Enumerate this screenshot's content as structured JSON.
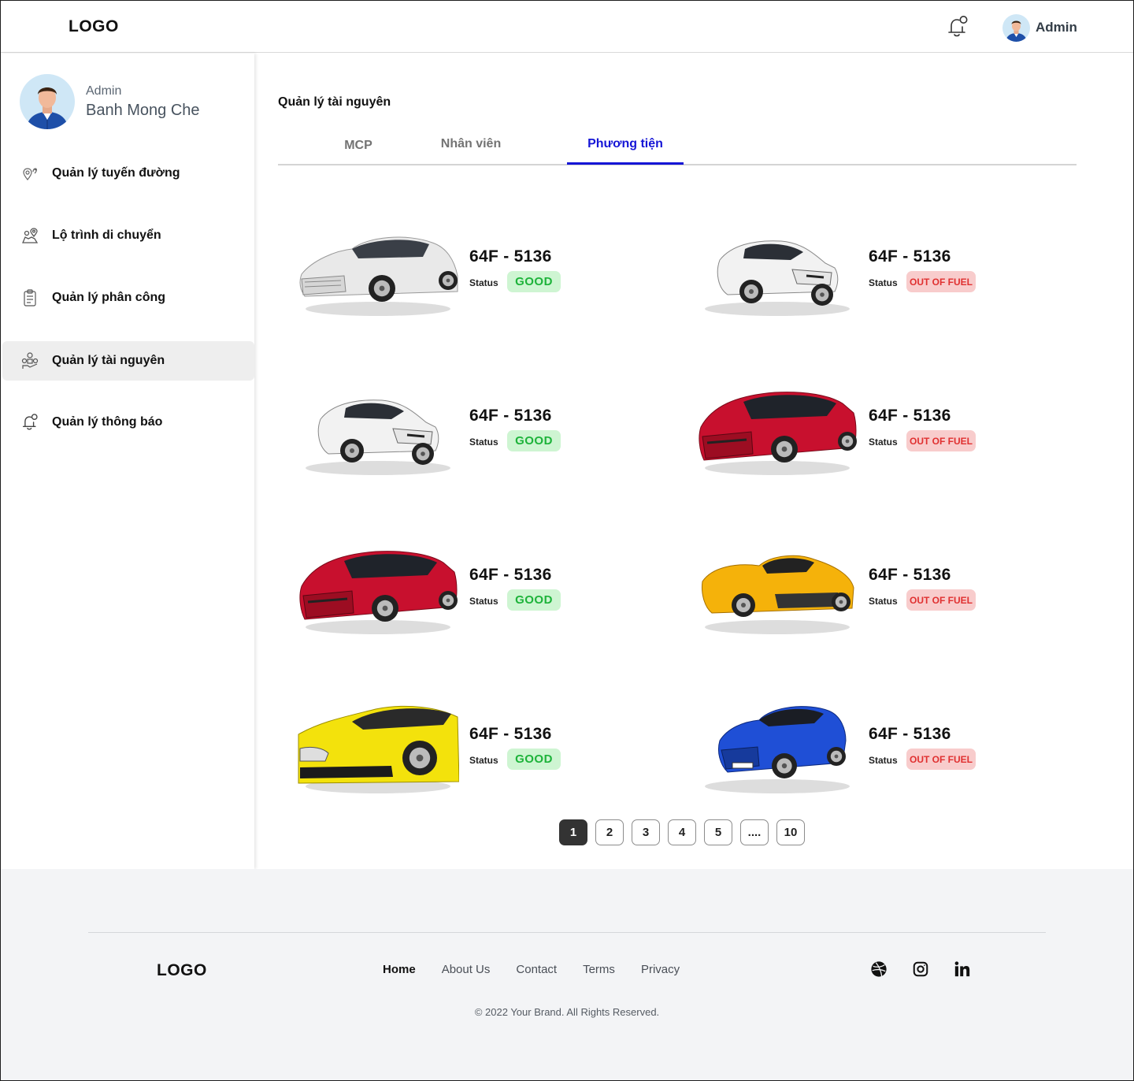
{
  "header": {
    "logo": "LOGO",
    "user_name": "Admin"
  },
  "sidebar": {
    "profile": {
      "role": "Admin",
      "name": "Banh Mong Che"
    },
    "items": [
      {
        "label": "Quản lý tuyến đường",
        "icon": "route-pin-icon"
      },
      {
        "label": "Lộ trình di chuyển",
        "icon": "map-route-icon"
      },
      {
        "label": "Quản lý phân công",
        "icon": "clipboard-icon"
      },
      {
        "label": "Quản lý tài nguyên",
        "icon": "resources-icon",
        "active": true
      },
      {
        "label": "Quản lý thông báo",
        "icon": "bell-icon"
      }
    ]
  },
  "main": {
    "title": "Quản lý tài nguyên",
    "tabs": [
      {
        "label": "MCP"
      },
      {
        "label": "Nhân viên"
      },
      {
        "label": "Phương tiện",
        "active": true
      }
    ],
    "status_label": "Status",
    "vehicles": [
      {
        "plate": "64F - 5136",
        "status": "GOOD",
        "car": "white-sedan",
        "color": "#e9e9e9"
      },
      {
        "plate": "64F - 5136",
        "status": "OUT OF FUEL",
        "car": "white-hatchback",
        "color": "#f2f2f2"
      },
      {
        "plate": "64F - 5136",
        "status": "GOOD",
        "car": "white-hatchback",
        "color": "#f2f2f2"
      },
      {
        "plate": "64F - 5136",
        "status": "OUT OF FUEL",
        "car": "red-hatchback",
        "color": "#c8102e"
      },
      {
        "plate": "64F - 5136",
        "status": "GOOD",
        "car": "red-hatchback",
        "color": "#c8102e"
      },
      {
        "plate": "64F - 5136",
        "status": "OUT OF FUEL",
        "car": "yellow-sports-car",
        "color": "#f5b20a"
      },
      {
        "plate": "64F - 5136",
        "status": "GOOD",
        "car": "yellow-porsche",
        "color": "#f3e20c"
      },
      {
        "plate": "64F - 5136",
        "status": "OUT OF FUEL",
        "car": "blue-sedan",
        "color": "#1f4fd6"
      }
    ],
    "pagination": [
      "1",
      "2",
      "3",
      "4",
      "5",
      "....",
      "10"
    ],
    "current_page": "1"
  },
  "footer": {
    "logo": "LOGO",
    "links": [
      "Home",
      "About Us",
      "Contact",
      "Terms",
      "Privacy"
    ],
    "social": [
      "dribbble-icon",
      "instagram-icon",
      "linkedin-icon"
    ],
    "copyright": "© 2022 Your Brand. All Rights Reserved."
  }
}
